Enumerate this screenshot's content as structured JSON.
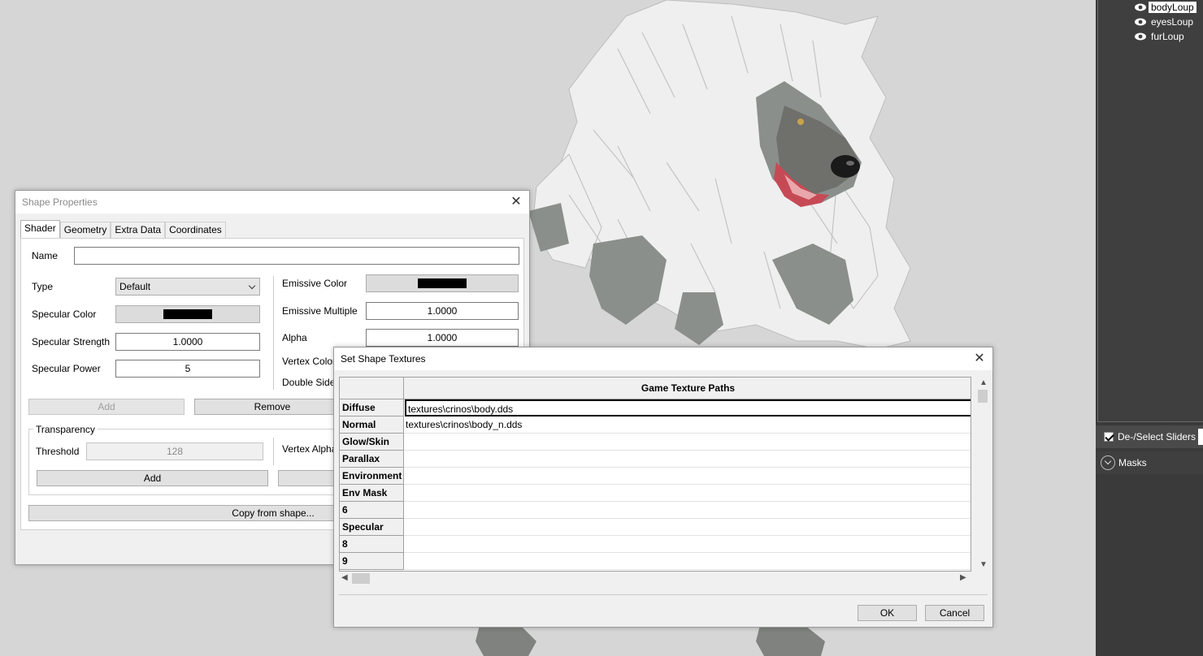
{
  "shape_tree": {
    "items": [
      {
        "label": "bodyLoup",
        "selected": true
      },
      {
        "label": "eyesLoup",
        "selected": false
      },
      {
        "label": "furLoup",
        "selected": false
      }
    ]
  },
  "side_panel": {
    "deselect_sliders_label": "De-/Select Sliders",
    "masks_label": "Masks"
  },
  "shape_properties": {
    "title": "Shape Properties",
    "close": "✕",
    "tabs": [
      "Shader",
      "Geometry",
      "Extra Data",
      "Coordinates"
    ],
    "active_tab": "Shader",
    "name_label": "Name",
    "name_value": "",
    "type_label": "Type",
    "type_value": "Default",
    "specular_color_label": "Specular Color",
    "specular_color": "#000000",
    "specular_strength_label": "Specular Strength",
    "specular_strength_value": "1.0000",
    "specular_power_label": "Specular Power",
    "specular_power_value": "5",
    "emissive_color_label": "Emissive Color",
    "emissive_color": "#000000",
    "emissive_multiple_label": "Emissive Multiple",
    "emissive_multiple_value": "1.0000",
    "alpha_label": "Alpha",
    "alpha_value": "1.0000",
    "vertex_colors_label": "Vertex Colors",
    "double_sided_label": "Double Sided",
    "add_shader_label": "Add",
    "remove_shader_label": "Remove",
    "transparency_label": "Transparency",
    "threshold_label": "Threshold",
    "threshold_value": "128",
    "vertex_alpha_label": "Vertex Alpha",
    "add_transparency_label": "Add",
    "copy_from_shape_label": "Copy from shape..."
  },
  "set_shape_textures": {
    "title": "Set Shape Textures",
    "close": "✕",
    "column_header": "Game Texture Paths",
    "rows": [
      {
        "label": "Diffuse",
        "value": "textures\\crinos\\body.dds"
      },
      {
        "label": "Normal",
        "value": "textures\\crinos\\body_n.dds"
      },
      {
        "label": "Glow/Skin",
        "value": ""
      },
      {
        "label": "Parallax",
        "value": ""
      },
      {
        "label": "Environment",
        "value": ""
      },
      {
        "label": "Env Mask",
        "value": ""
      },
      {
        "label": "6",
        "value": ""
      },
      {
        "label": "Specular",
        "value": ""
      },
      {
        "label": "8",
        "value": ""
      },
      {
        "label": "9",
        "value": ""
      }
    ],
    "ok_label": "OK",
    "cancel_label": "Cancel"
  }
}
